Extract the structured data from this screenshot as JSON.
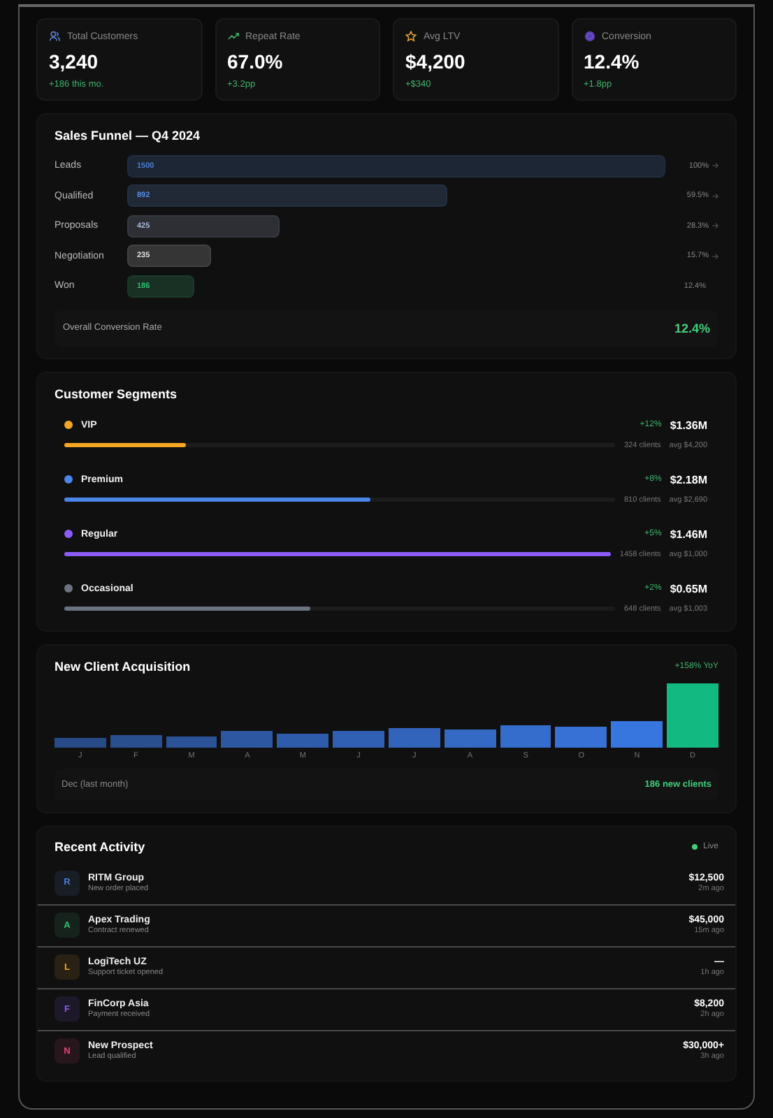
{
  "kpis": [
    {
      "kind": "users",
      "label": "Total Customers",
      "value": "3,240",
      "delta": "+186 this mo."
    },
    {
      "kind": "trend",
      "label": "Repeat Rate",
      "value": "67.0%",
      "delta": "+3.2pp"
    },
    {
      "kind": "star",
      "label": "Avg LTV",
      "value": "$4,200",
      "delta": "+$340"
    },
    {
      "kind": "target",
      "label": "Conversion",
      "value": "12.4%",
      "delta": "+1.8pp"
    }
  ],
  "funnel": {
    "title": "Sales Funnel — Q4 2024",
    "stages": [
      {
        "label": "Leads",
        "count": "1500",
        "color": "#4a7fd6",
        "share": "100%",
        "arrow": true
      },
      {
        "label": "Qualified",
        "count": "892",
        "color": "#5a8fe0",
        "share": "59.5%",
        "arrow": true
      },
      {
        "label": "Proposals",
        "count": "425",
        "color": "#a8b8d8",
        "share": "28.3%",
        "arrow": true
      },
      {
        "label": "Negotiation",
        "count": "235",
        "color": "#e0e0e0",
        "share": "15.7%",
        "arrow": true
      },
      {
        "label": "Won",
        "count": "186",
        "color": "#2fbf71",
        "share": "12.4%",
        "arrow": false
      }
    ],
    "summary_label": "Overall Conversion Rate",
    "summary_value": "12.4%"
  },
  "segments": {
    "title": "Customer Segments",
    "items": [
      {
        "name": "VIP",
        "color": "#f5a623",
        "growth": "+12%",
        "revenue": "$1.36M",
        "level": 0.22,
        "clients": "324 clients",
        "avg": "avg $4,200"
      },
      {
        "name": "Premium",
        "color": "#4a86e8",
        "growth": "+8%",
        "revenue": "$2.18M",
        "level": 0.555,
        "clients": "810 clients",
        "avg": "avg $2,690"
      },
      {
        "name": "Regular",
        "color": "#8b5cf6",
        "growth": "+5%",
        "revenue": "$1.46M",
        "level": 1.0,
        "clients": "1458 clients",
        "avg": "avg $1,000"
      },
      {
        "name": "Occasional",
        "color": "#6b7280",
        "growth": "+2%",
        "revenue": "$0.65M",
        "level": 0.445,
        "clients": "648 clients",
        "avg": "avg $1,003"
      }
    ]
  },
  "acquisition": {
    "title": "New Client Acquisition",
    "trend": "+158% YoY",
    "months": [
      {
        "label": "J",
        "selected": false
      },
      {
        "label": "F",
        "selected": false
      },
      {
        "label": "M",
        "selected": false
      },
      {
        "label": "A",
        "selected": false
      },
      {
        "label": "M",
        "selected": false
      },
      {
        "label": "J",
        "selected": false
      },
      {
        "label": "J",
        "selected": false
      },
      {
        "label": "A",
        "selected": false
      },
      {
        "label": "S",
        "selected": false
      },
      {
        "label": "O",
        "selected": false
      },
      {
        "label": "N",
        "selected": false
      },
      {
        "label": "D",
        "selected": true
      }
    ],
    "footer_label": "Dec (last month)",
    "footer_value": "186 new clients"
  },
  "activity": {
    "title": "Recent Activity",
    "status": "Live",
    "items": [
      {
        "initial": "R",
        "color": "#4a7fd6",
        "name": "RITM Group",
        "event": "New order placed",
        "amount": "$12,500",
        "time": "2m ago"
      },
      {
        "initial": "A",
        "color": "#2fbf71",
        "name": "Apex Trading",
        "event": "Contract renewed",
        "amount": "$45,000",
        "time": "15m ago"
      },
      {
        "initial": "L",
        "color": "#f5a623",
        "name": "LogiTech UZ",
        "event": "Support ticket opened",
        "amount": "—",
        "time": "1h ago"
      },
      {
        "initial": "F",
        "color": "#8b5cf6",
        "name": "FinCorp Asia",
        "event": "Payment received",
        "amount": "$8,200",
        "time": "2h ago"
      },
      {
        "initial": "N",
        "color": "#e0457b",
        "name": "New Prospect",
        "event": "Lead qualified",
        "amount": "$30,000+",
        "time": "3h ago"
      }
    ]
  }
}
